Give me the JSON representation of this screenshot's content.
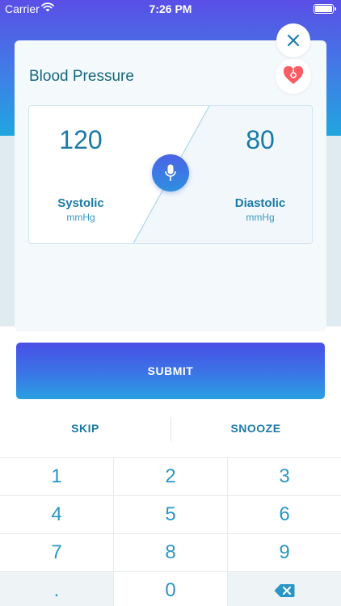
{
  "status_bar": {
    "carrier": "Carrier",
    "time": "7:26 PM"
  },
  "card": {
    "title": "Blood Pressure",
    "systolic": {
      "value": "120",
      "label": "Systolic",
      "unit": "mmHg"
    },
    "diastolic": {
      "value": "80",
      "label": "Diastolic",
      "unit": "mmHg"
    }
  },
  "actions": {
    "submit": "SUBMIT",
    "skip": "SKIP",
    "snooze": "SNOOZE"
  },
  "keypad": {
    "keys": [
      "1",
      "2",
      "3",
      "4",
      "5",
      "6",
      "7",
      "8",
      "9",
      ".",
      "0"
    ]
  },
  "colors": {
    "accent": "#1b79a8",
    "heart": "#ff5b63",
    "gradient_start": "#4a4ee6",
    "gradient_end": "#2aa0e2"
  },
  "icons": {
    "close": "close-icon",
    "heart": "heart-icon",
    "microphone": "microphone-icon",
    "backspace": "backspace-icon"
  }
}
